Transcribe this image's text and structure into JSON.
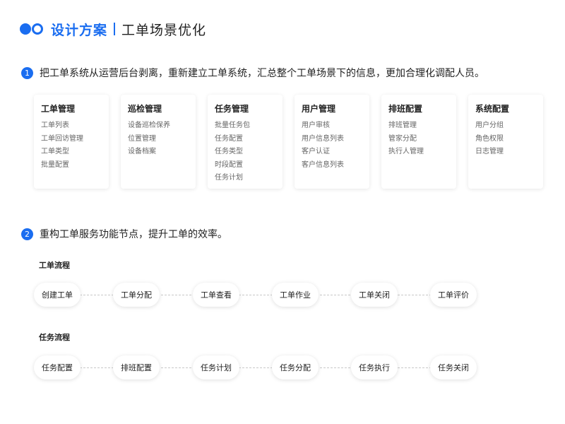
{
  "header": {
    "brand": "设计方案",
    "title": "工单场景优化"
  },
  "steps": [
    {
      "num": "1",
      "text": "把工单系统从运营后台剥离，重新建立工单系统，汇总整个工单场景下的信息，更加合理化调配人员。"
    },
    {
      "num": "2",
      "text": "重构工单服务功能节点，提升工单的效率。"
    }
  ],
  "modules": [
    {
      "title": "工单管理",
      "items": [
        "工单列表",
        "工单回访管理",
        "工单类型",
        "批量配置"
      ]
    },
    {
      "title": "巡检管理",
      "items": [
        "设备巡检保养",
        "位置管理",
        "设备档案"
      ]
    },
    {
      "title": "任务管理",
      "items": [
        "批量任务包",
        "任务配置",
        "任务类型",
        "时段配置",
        "任务计划"
      ]
    },
    {
      "title": "用户管理",
      "items": [
        "用户审核",
        "用户信息列表",
        "客户认证",
        "客户信息列表"
      ]
    },
    {
      "title": "排班配置",
      "items": [
        "排班管理",
        "管家分配",
        "执行人管理"
      ]
    },
    {
      "title": "系统配置",
      "items": [
        "用户分组",
        "角色权限",
        "日志管理"
      ]
    }
  ],
  "flows": [
    {
      "title": "工单流程",
      "nodes": [
        "创建工单",
        "工单分配",
        "工单查看",
        "工单作业",
        "工单关闭",
        "工单评价"
      ]
    },
    {
      "title": "任务流程",
      "nodes": [
        "任务配置",
        "排班配置",
        "任务计划",
        "任务分配",
        "任务执行",
        "任务关闭"
      ]
    }
  ],
  "colors": {
    "accent": "#1a6df0"
  }
}
